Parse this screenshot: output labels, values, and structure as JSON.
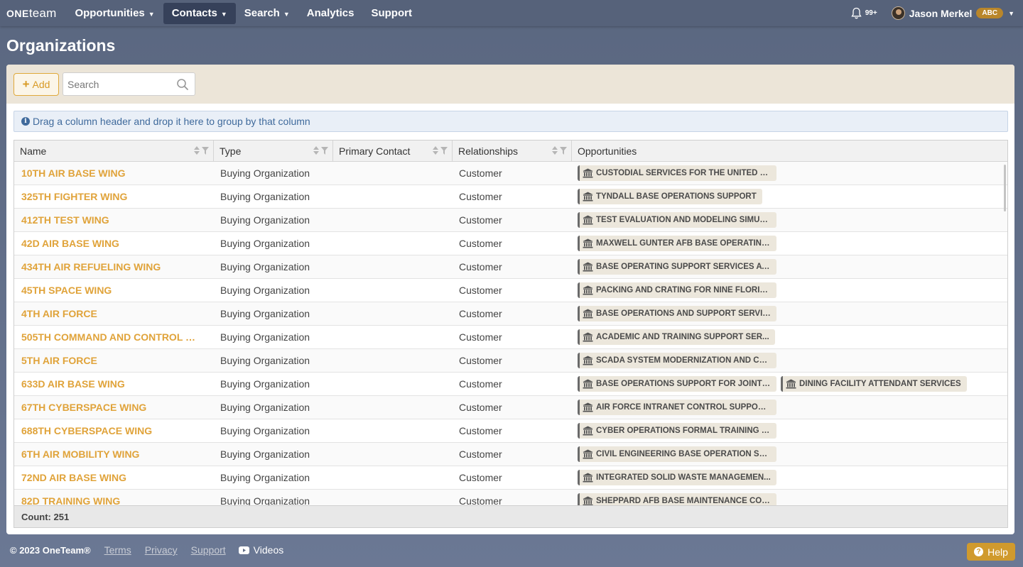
{
  "app": {
    "logo_one": "ONE",
    "logo_team": "team"
  },
  "nav": {
    "items": [
      {
        "label": "Opportunities",
        "caret": true
      },
      {
        "label": "Contacts",
        "caret": true
      },
      {
        "label": "Search",
        "caret": true
      },
      {
        "label": "Analytics",
        "caret": false
      },
      {
        "label": "Support",
        "caret": false
      }
    ],
    "active": "Contacts",
    "notifications": "99+",
    "user_name": "Jason Merkel",
    "user_badge": "ABC"
  },
  "page": {
    "title": "Organizations"
  },
  "toolbar": {
    "add_label": "Add",
    "search_placeholder": "Search"
  },
  "group_hint": "Drag a column header and drop it here to group by that column",
  "grid": {
    "columns": [
      "Name",
      "Type",
      "Primary Contact",
      "Relationships",
      "Opportunities"
    ],
    "rows": [
      {
        "name": "10TH AIR BASE WING",
        "type": "Buying Organization",
        "contact": "",
        "rel": "Customer",
        "opps": [
          "CUSTODIAL SERVICES FOR THE UNITED ST..."
        ]
      },
      {
        "name": "325TH FIGHTER WING",
        "type": "Buying Organization",
        "contact": "",
        "rel": "Customer",
        "opps": [
          "TYNDALL BASE OPERATIONS SUPPORT"
        ]
      },
      {
        "name": "412TH TEST WING",
        "type": "Buying Organization",
        "contact": "",
        "rel": "Customer",
        "opps": [
          "TEST EVALUATION AND MODELING SIMUL..."
        ]
      },
      {
        "name": "42D AIR BASE WING",
        "type": "Buying Organization",
        "contact": "",
        "rel": "Customer",
        "opps": [
          "MAXWELL GUNTER AFB BASE OPERATING..."
        ]
      },
      {
        "name": "434TH AIR REFUELING WING",
        "type": "Buying Organization",
        "contact": "",
        "rel": "Customer",
        "opps": [
          "BASE OPERATING SUPPORT SERVICES AT ..."
        ]
      },
      {
        "name": "45TH SPACE WING",
        "type": "Buying Organization",
        "contact": "",
        "rel": "Customer",
        "opps": [
          "PACKING AND CRATING FOR NINE FLORID..."
        ]
      },
      {
        "name": "4TH AIR FORCE",
        "type": "Buying Organization",
        "contact": "",
        "rel": "Customer",
        "opps": [
          "BASE OPERATIONS AND SUPPORT SERVIC..."
        ]
      },
      {
        "name": "505TH COMMAND AND CONTROL WI...",
        "type": "Buying Organization",
        "contact": "",
        "rel": "Customer",
        "opps": [
          "ACADEMIC AND TRAINING SUPPORT SER..."
        ]
      },
      {
        "name": "5TH AIR FORCE",
        "type": "Buying Organization",
        "contact": "",
        "rel": "Customer",
        "opps": [
          "SCADA SYSTEM MODERNIZATION AND CE..."
        ]
      },
      {
        "name": "633D AIR BASE WING",
        "type": "Buying Organization",
        "contact": "",
        "rel": "Customer",
        "opps": [
          "BASE OPERATIONS SUPPORT FOR JOINT B...",
          "DINING FACILITY ATTENDANT SERVICES"
        ]
      },
      {
        "name": "67TH CYBERSPACE WING",
        "type": "Buying Organization",
        "contact": "",
        "rel": "Customer",
        "opps": [
          "AIR FORCE INTRANET CONTROL SUPPORT II"
        ]
      },
      {
        "name": "688TH CYBERSPACE WING",
        "type": "Buying Organization",
        "contact": "",
        "rel": "Customer",
        "opps": [
          "CYBER OPERATIONS FORMAL TRAINING S..."
        ]
      },
      {
        "name": "6TH AIR MOBILITY WING",
        "type": "Buying Organization",
        "contact": "",
        "rel": "Customer",
        "opps": [
          "CIVIL ENGINEERING BASE OPERATION SU..."
        ]
      },
      {
        "name": "72ND AIR BASE WING",
        "type": "Buying Organization",
        "contact": "",
        "rel": "Customer",
        "opps": [
          "INTEGRATED SOLID WASTE MANAGEMEN..."
        ]
      },
      {
        "name": "82D TRAINING WING",
        "type": "Buying Organization",
        "contact": "",
        "rel": "Customer",
        "opps": [
          "SHEPPARD AFB BASE MAINTENANCE CON..."
        ]
      }
    ],
    "count_label": "Count: 251"
  },
  "footer": {
    "copyright": "© 2023 OneTeam®",
    "links": [
      "Terms",
      "Privacy",
      "Support"
    ],
    "videos": "Videos",
    "help": "Help"
  },
  "colors": {
    "accent": "#e0a33a",
    "nav_bg": "#56627a",
    "active_nav": "#36415a"
  }
}
